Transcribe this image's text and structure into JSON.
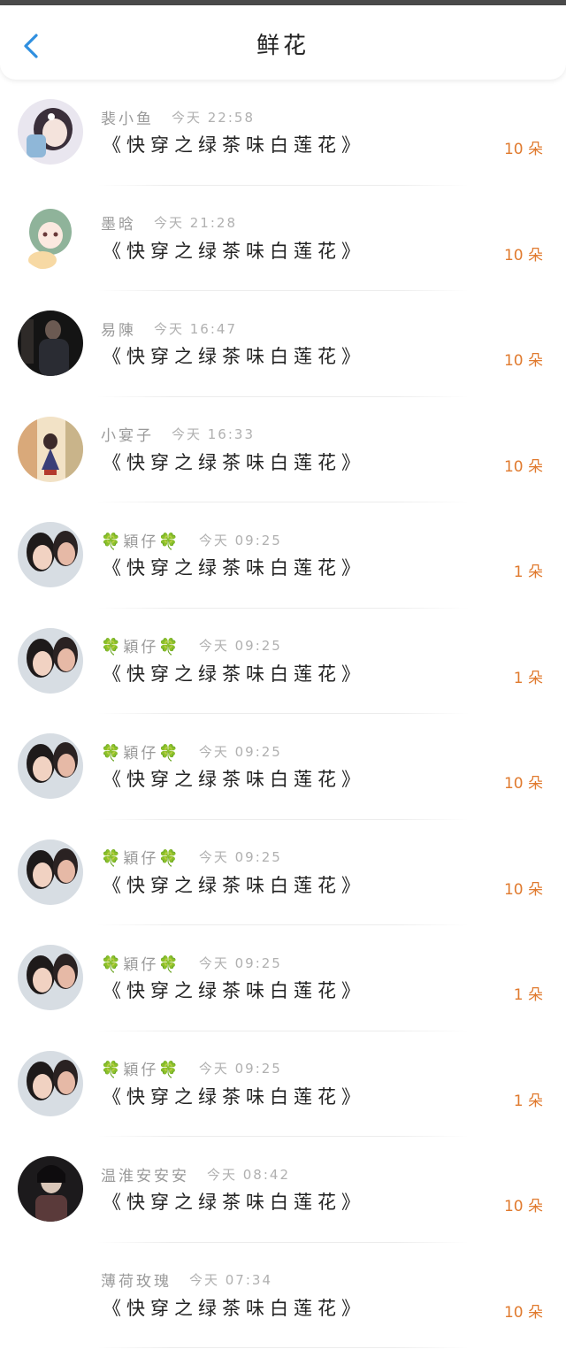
{
  "header": {
    "title": "鲜花"
  },
  "colors": {
    "count": "#e07a2e",
    "back_arrow": "#2f8fe0"
  },
  "records": [
    {
      "name": "裴小鱼",
      "time": "今天 22:58",
      "book": "《快穿之绿茶味白莲花》",
      "count": "10 朵",
      "avatar": "anime-girl-avatar",
      "clover": false
    },
    {
      "name": "墨晗",
      "time": "今天 21:28",
      "book": "《快穿之绿茶味白莲花》",
      "count": "10 朵",
      "avatar": "green-hair-girl-avatar",
      "clover": false
    },
    {
      "name": "易陳",
      "time": "今天 16:47",
      "book": "《快穿之绿茶味白莲花》",
      "count": "10 朵",
      "avatar": "man-in-dark-avatar",
      "clover": false
    },
    {
      "name": "小宴子",
      "time": "今天 16:33",
      "book": "《快穿之绿茶味白莲花》",
      "count": "10 朵",
      "avatar": "witch-girl-avatar",
      "clover": false
    },
    {
      "name": "穎仔",
      "time": "今天 09:25",
      "book": "《快穿之绿茶味白莲花》",
      "count": "1 朵",
      "avatar": "two-girls-photo-avatar",
      "clover": true
    },
    {
      "name": "穎仔",
      "time": "今天 09:25",
      "book": "《快穿之绿茶味白莲花》",
      "count": "1 朵",
      "avatar": "two-girls-photo-avatar",
      "clover": true
    },
    {
      "name": "穎仔",
      "time": "今天 09:25",
      "book": "《快穿之绿茶味白莲花》",
      "count": "10 朵",
      "avatar": "two-girls-photo-avatar",
      "clover": true
    },
    {
      "name": "穎仔",
      "time": "今天 09:25",
      "book": "《快穿之绿茶味白莲花》",
      "count": "10 朵",
      "avatar": "two-girls-photo-avatar",
      "clover": true
    },
    {
      "name": "穎仔",
      "time": "今天 09:25",
      "book": "《快穿之绿茶味白莲花》",
      "count": "1 朵",
      "avatar": "two-girls-photo-avatar",
      "clover": true
    },
    {
      "name": "穎仔",
      "time": "今天 09:25",
      "book": "《快穿之绿茶味白莲花》",
      "count": "1 朵",
      "avatar": "two-girls-photo-avatar",
      "clover": true
    },
    {
      "name": "温淮安安安",
      "time": "今天 08:42",
      "book": "《快穿之绿茶味白莲花》",
      "count": "10 朵",
      "avatar": "ancient-costume-avatar",
      "clover": false
    },
    {
      "name": "薄荷玫瑰",
      "time": "今天 07:34",
      "book": "《快穿之绿茶味白莲花》",
      "count": "10 朵",
      "avatar": "",
      "clover": false
    }
  ]
}
